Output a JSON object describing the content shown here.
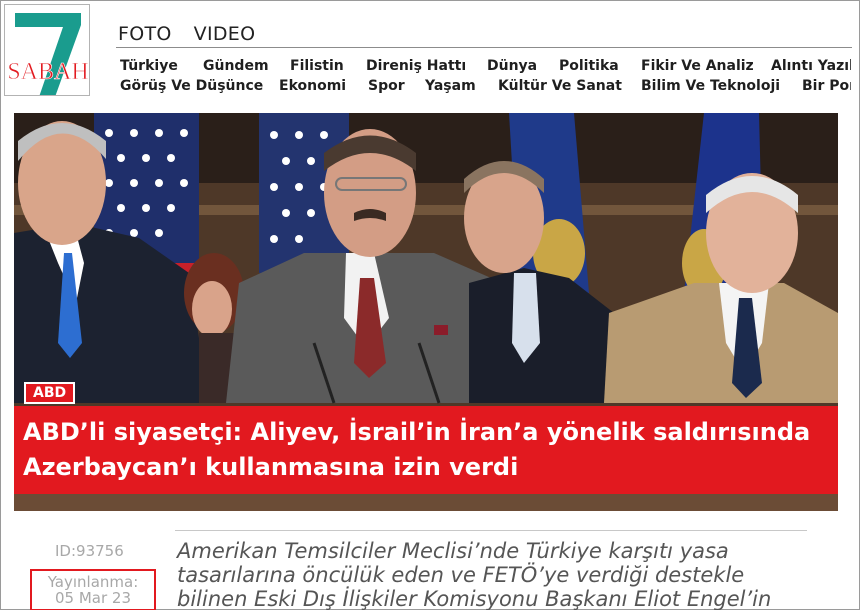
{
  "brand": {
    "logo_text": "SABAH",
    "logo_numeral": "7",
    "accent_teal": "#1a9c8e",
    "brand_red": "#e2191f"
  },
  "media_nav": [
    "FOTO",
    "VIDEO"
  ],
  "nav": {
    "row1": [
      "Türkiye",
      "Gündem",
      "Filistin",
      "Direniş Hattı",
      "Dünya",
      "Politika",
      "Fikir Ve Analiz",
      "Alıntı Yazıl"
    ],
    "row2": [
      "Görüş Ve Düşünce",
      "Ekonomi",
      "Spor",
      "Yaşam",
      "Kültür Ve Sanat",
      "Bilim Ve Teknoloji",
      "Bir Por"
    ]
  },
  "hero": {
    "category": "ABD",
    "headline_lines": [
      "ABD’li siyasetçi: Aliyev, İsrail’in İran’a yönelik saldırısında",
      "Azerbaycan’ı kullanmasına izin verdi"
    ]
  },
  "article": {
    "id_label": "ID:93756",
    "published_label": "Yayınlanma:",
    "published_date": "05 Mar 23",
    "lead_lines": [
      "Amerikan Temsilciler Meclisi’nde Türkiye karşıtı yasa",
      "tasarılarına öncülük eden ve FETÖ’ye verdiği destekle",
      "bilinen Eski Dış İlişkiler Komisyonu Başkanı Eliot Engel’in"
    ]
  }
}
